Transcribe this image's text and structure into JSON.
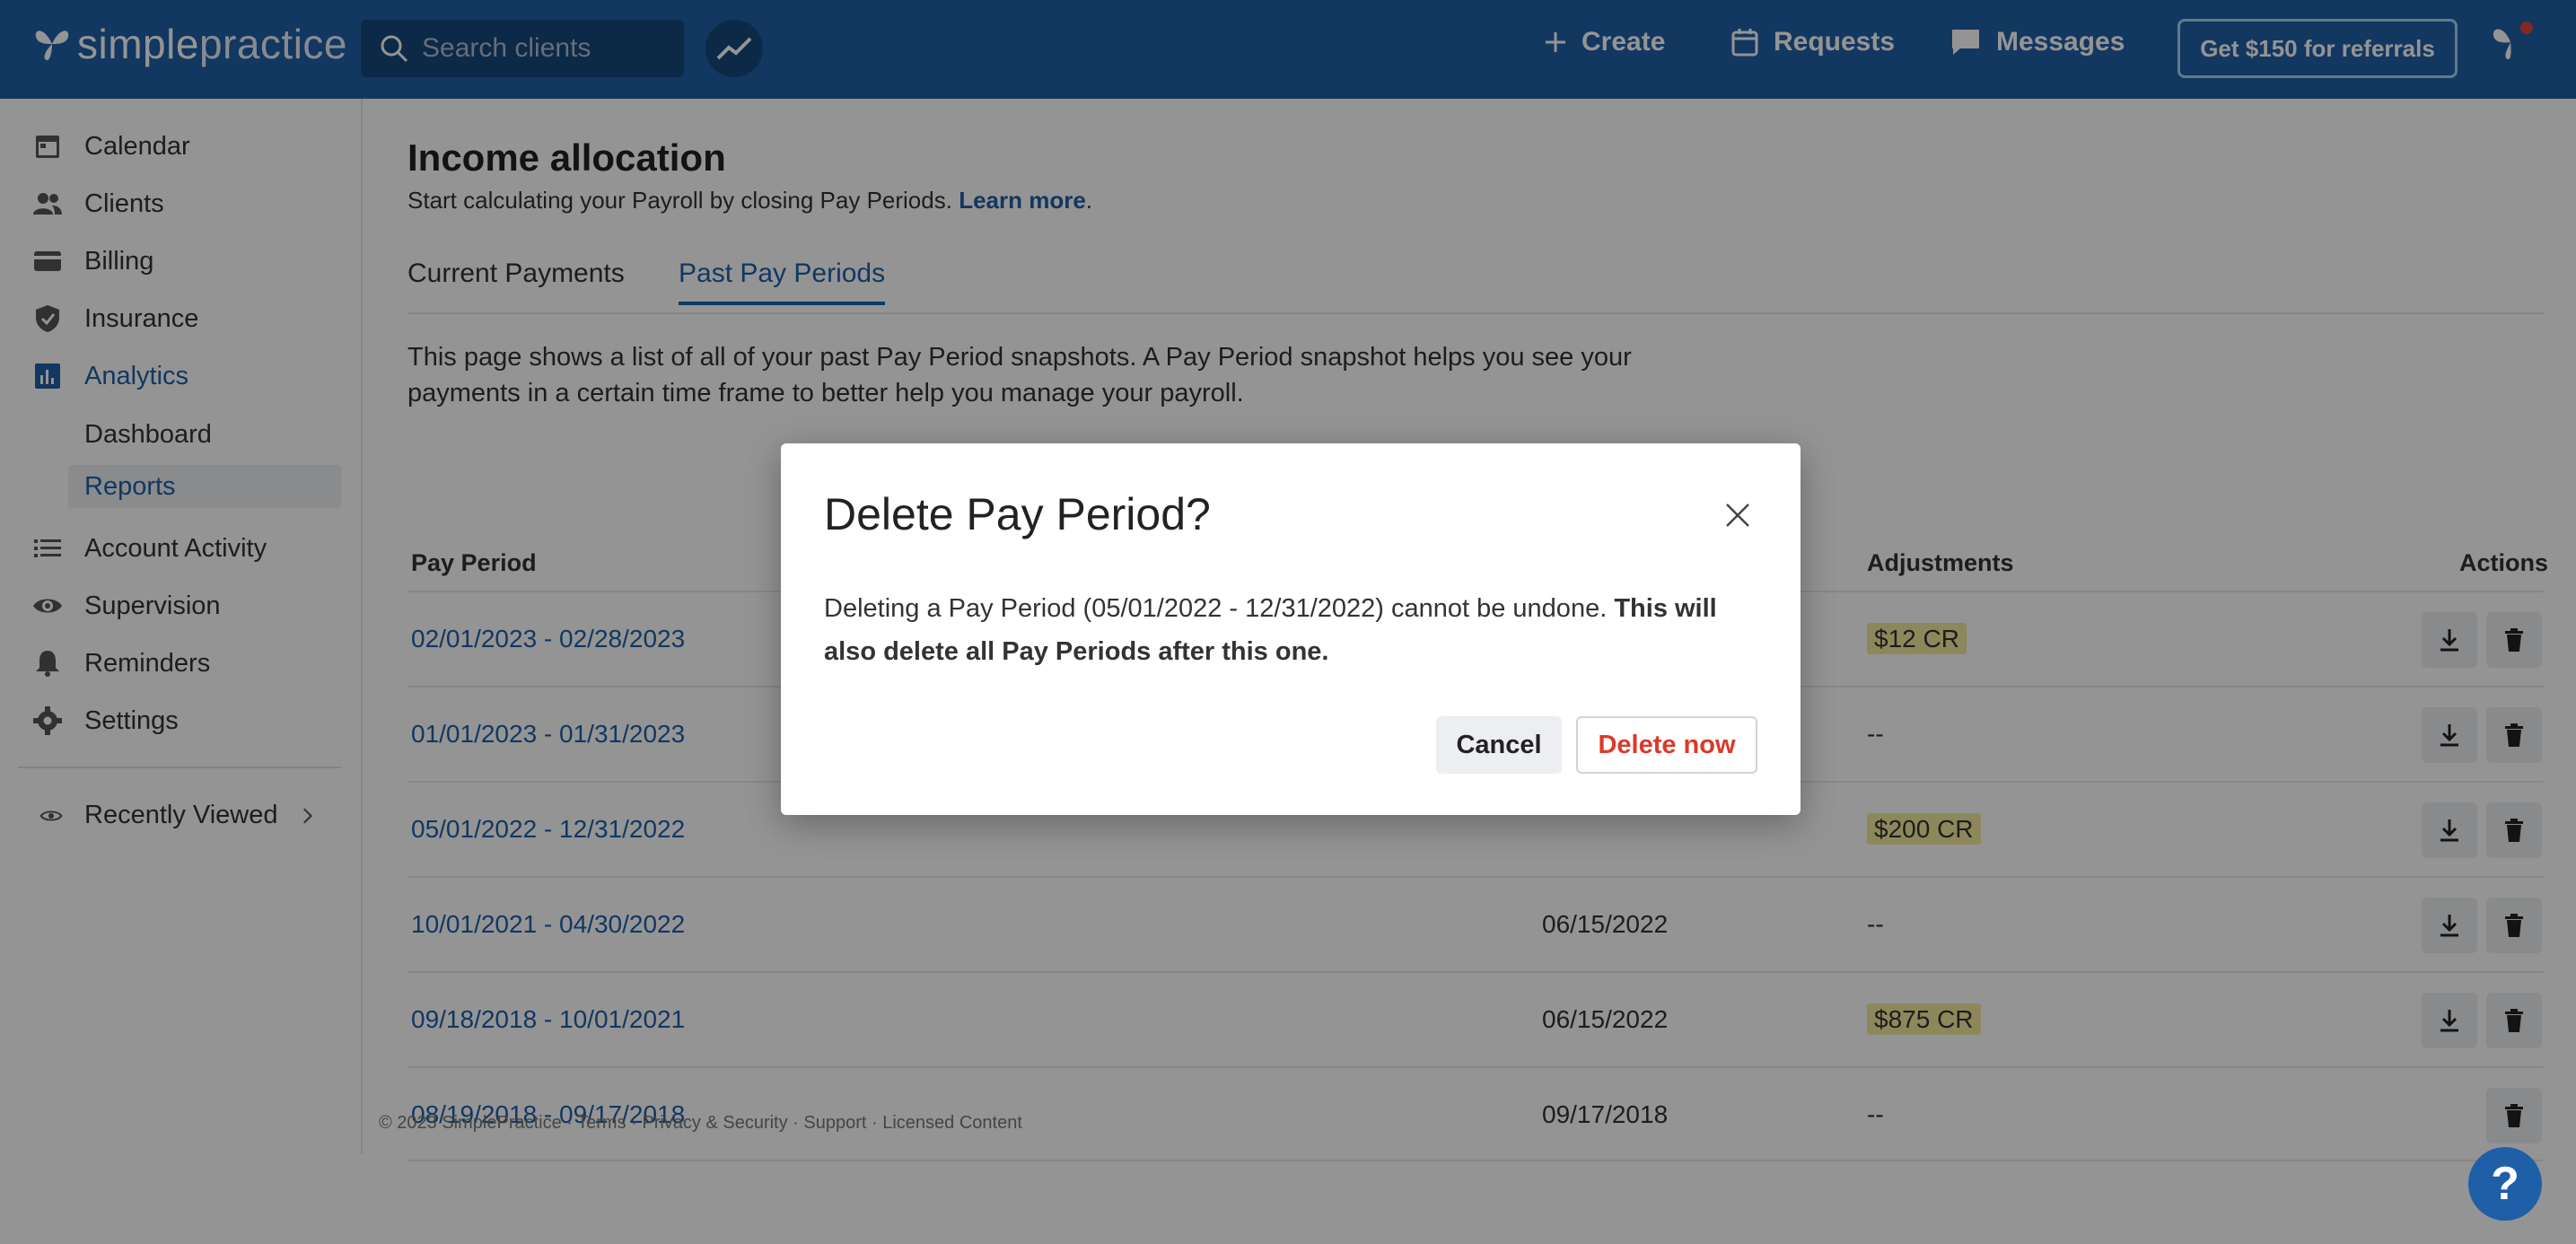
{
  "topbar": {
    "logo_bold": "simple",
    "logo_light": "practice",
    "search_placeholder": "Search clients",
    "create": "Create",
    "requests": "Requests",
    "messages": "Messages",
    "referral": "Get $150 for referrals"
  },
  "sidebar": {
    "items": [
      {
        "label": "Calendar",
        "icon": "calendar-icon"
      },
      {
        "label": "Clients",
        "icon": "clients-icon"
      },
      {
        "label": "Billing",
        "icon": "billing-icon"
      },
      {
        "label": "Insurance",
        "icon": "shield-icon"
      },
      {
        "label": "Analytics",
        "icon": "analytics-icon"
      },
      {
        "label": "Account Activity",
        "icon": "list-icon"
      },
      {
        "label": "Supervision",
        "icon": "eye-icon"
      },
      {
        "label": "Reminders",
        "icon": "bell-icon"
      },
      {
        "label": "Settings",
        "icon": "gear-icon"
      }
    ],
    "sub_items": [
      "Dashboard",
      "Reports"
    ],
    "recently_viewed": "Recently Viewed"
  },
  "main": {
    "title": "Income allocation",
    "subtitle": "Start calculating your Payroll by closing Pay Periods.",
    "learn_more": "Learn more",
    "tabs": [
      "Current Payments",
      "Past Pay Periods"
    ],
    "description": "This page shows a list of all of your past Pay Period snapshots. A Pay Period snapshot helps you see your payments in a certain time frame to better help you manage your payroll.",
    "columns": [
      "Pay Period",
      "Adjustments",
      "Actions"
    ],
    "rows": [
      {
        "period": "02/01/2023 - 02/28/2023",
        "date": "",
        "adjustment": "$12 CR",
        "badge": true
      },
      {
        "period": "01/01/2023 - 01/31/2023",
        "date": "",
        "adjustment": "--",
        "badge": false
      },
      {
        "period": "05/01/2022 - 12/31/2022",
        "date": "",
        "adjustment": "$200 CR",
        "badge": true
      },
      {
        "period": "10/01/2021 - 04/30/2022",
        "date": "06/15/2022",
        "adjustment": "--",
        "badge": false
      },
      {
        "period": "09/18/2018 - 10/01/2021",
        "date": "06/15/2022",
        "adjustment": "$875 CR",
        "badge": true
      },
      {
        "period": "08/19/2018 - 09/17/2018",
        "date": "09/17/2018",
        "adjustment": "--",
        "badge": false
      }
    ]
  },
  "footer": "© 2023 SimplePractice · Terms · Privacy & Security · Support · Licensed Content",
  "modal": {
    "title": "Delete Pay Period?",
    "body_plain": "Deleting a Pay Period (05/01/2022 - 12/31/2022) cannot be undone.",
    "body_bold": "This will also delete all Pay Periods after this one.",
    "cancel": "Cancel",
    "delete": "Delete now"
  },
  "help": "?",
  "colors": {
    "brand": "#1f5fa8",
    "danger": "#d93a2a",
    "badge": "#f3ea9e"
  }
}
